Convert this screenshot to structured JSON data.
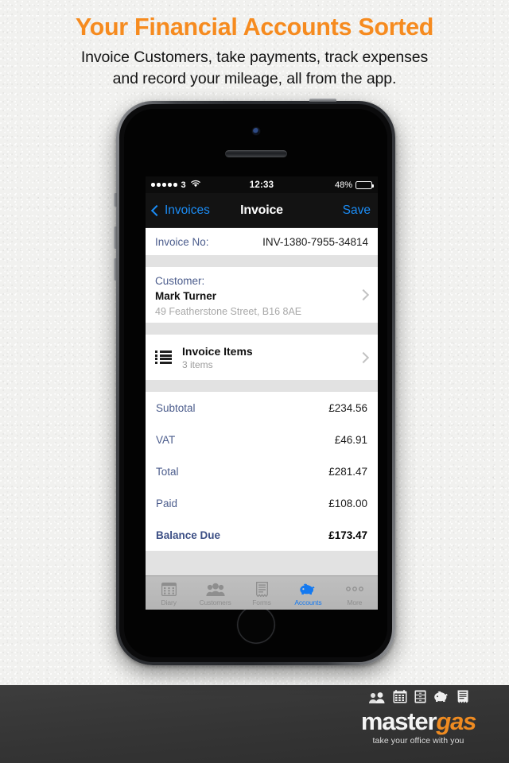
{
  "promo": {
    "headline": "Your Financial Accounts Sorted",
    "subheadline_line1": "Invoice Customers, take payments, track expenses",
    "subheadline_line2": "and record your mileage, all from the app.",
    "headline_color": "#f68b1f"
  },
  "phone": {
    "status_bar": {
      "signal_dots": 5,
      "carrier": "3",
      "wifi_icon": "wifi-icon",
      "time": "12:33",
      "battery_percent": "48%",
      "battery_level": 48
    },
    "nav_bar": {
      "back_label": "Invoices",
      "back_icon": "chevron-left-icon",
      "title": "Invoice",
      "action_label": "Save",
      "accent_color": "#1b8cf5"
    },
    "invoice": {
      "invoice_no_label": "Invoice No:",
      "invoice_no_value": "INV-1380-7955-34814",
      "customer_label": "Customer:",
      "customer_name": "Mark Turner",
      "customer_address": "49 Featherstone Street, B16 8AE",
      "items_title": "Invoice Items",
      "items_subtitle": "3 items",
      "items_icon": "list-icon",
      "disclosure_icon": "chevron-right-icon",
      "totals": [
        {
          "label": "Subtotal",
          "value": "£234.56",
          "emphasis": false
        },
        {
          "label": "VAT",
          "value": "£46.91",
          "emphasis": false
        },
        {
          "label": "Total",
          "value": "£281.47",
          "emphasis": false
        },
        {
          "label": "Paid",
          "value": "£108.00",
          "emphasis": false
        },
        {
          "label": "Balance Due",
          "value": "£173.47",
          "emphasis": true
        }
      ]
    },
    "tab_bar": {
      "active_color": "#1479f0",
      "tabs": [
        {
          "label": "Diary",
          "icon": "calendar-icon",
          "active": false
        },
        {
          "label": "Customers",
          "icon": "people-icon",
          "active": false
        },
        {
          "label": "Forms",
          "icon": "document-icon",
          "active": false
        },
        {
          "label": "Accounts",
          "icon": "piggy-bank-icon",
          "active": true
        },
        {
          "label": "More",
          "icon": "ellipsis-icon",
          "active": false
        }
      ]
    }
  },
  "footer": {
    "brand_first": "master",
    "brand_second": "gas",
    "tagline": "take your office with you",
    "brand_accent": "#ef8b21",
    "icons": [
      "people-icon",
      "calendar-icon",
      "filing-cabinet-icon",
      "piggy-bank-icon",
      "receipt-icon"
    ]
  }
}
